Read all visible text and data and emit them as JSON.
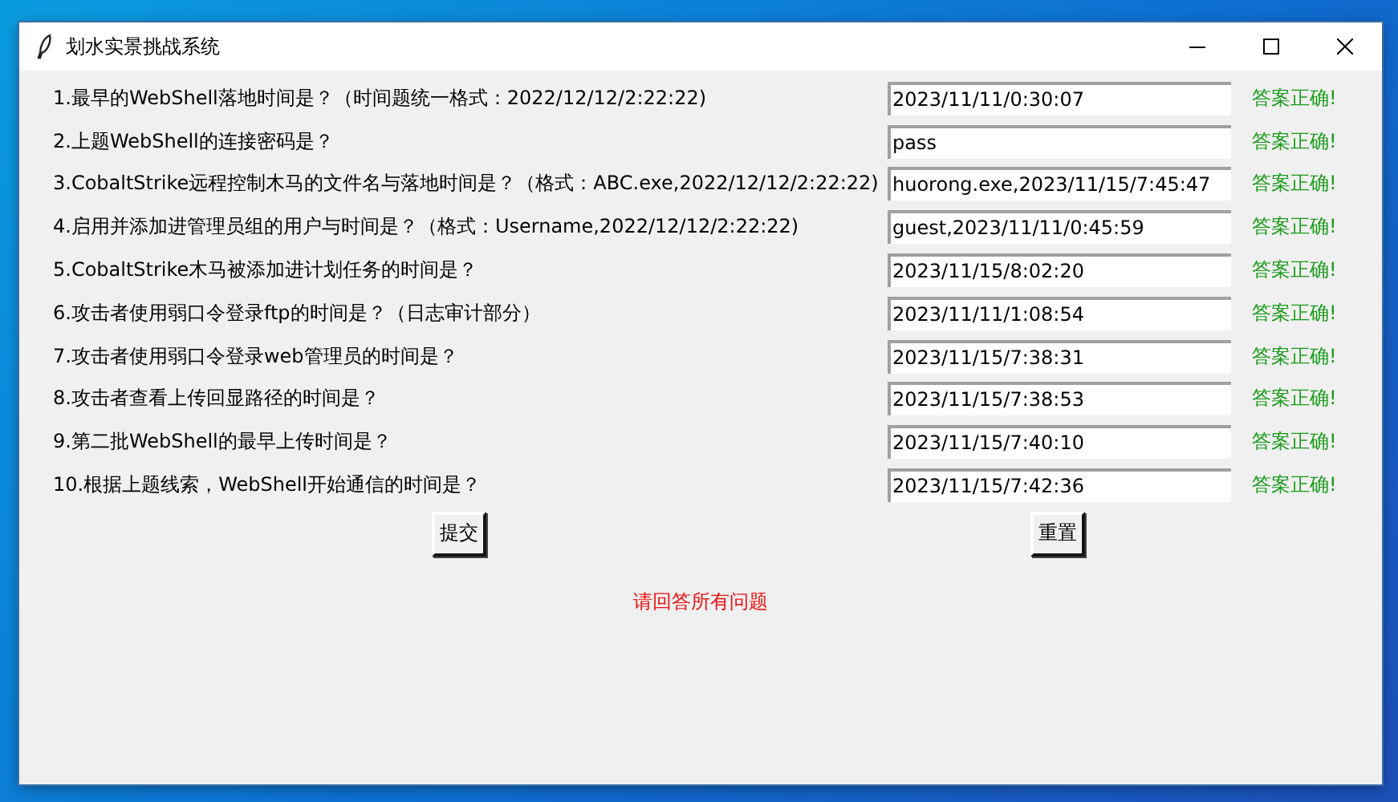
{
  "window": {
    "title": "划水实景挑战系统"
  },
  "questions": [
    {
      "label": "1.最早的WebShell落地时间是？（时间题统一格式：2022/12/12/2:22:22)",
      "answer": "2023/11/11/0:30:07",
      "result": "答案正确!",
      "correct": true
    },
    {
      "label": "2.上题WebShell的连接密码是？",
      "answer": "pass",
      "result": "答案正确!",
      "correct": true
    },
    {
      "label": "3.CobaltStrike远程控制木马的文件名与落地时间是？（格式：ABC.exe,2022/12/12/2:22:22)",
      "answer": "huorong.exe,2023/11/15/7:45:47",
      "result": "答案正确!",
      "correct": true
    },
    {
      "label": "4.启用并添加进管理员组的用户与时间是？（格式：Username,2022/12/12/2:22:22)",
      "answer": "guest,2023/11/11/0:45:59",
      "result": "答案正确!",
      "correct": true
    },
    {
      "label": "5.CobaltStrike木马被添加进计划任务的时间是？",
      "answer": "2023/11/15/8:02:20",
      "result": "答案正确!",
      "correct": true
    },
    {
      "label": "6.攻击者使用弱口令登录ftp的时间是？（日志审计部分）",
      "answer": "2023/11/11/1:08:54",
      "result": "答案正确!",
      "correct": true
    },
    {
      "label": "7.攻击者使用弱口令登录web管理员的时间是？",
      "answer": "2023/11/15/7:38:31",
      "result": "答案正确!",
      "correct": true
    },
    {
      "label": "8.攻击者查看上传回显路径的时间是？",
      "answer": "2023/11/15/7:38:53",
      "result": "答案正确!",
      "correct": true
    },
    {
      "label": "9.第二批WebShell的最早上传时间是？",
      "answer": "2023/11/15/7:40:10",
      "result": "答案正确!",
      "correct": true
    },
    {
      "label": "10.根据上题线索，WebShell开始通信的时间是？",
      "answer": "2023/11/15/7:42:36",
      "result": "答案正确!",
      "correct": true
    }
  ],
  "buttons": [
    "提交",
    "重置"
  ],
  "message": "请回答所有问题"
}
